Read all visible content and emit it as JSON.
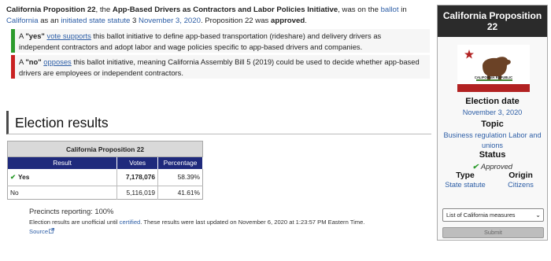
{
  "intro": {
    "title_bold": "California Proposition 22",
    "t1": ", the ",
    "initiative_name": "App-Based Drivers as Contractors and Labor Policies Initiative",
    "t2": ", was on the ",
    "link_ballot": "ballot",
    "t3": " in ",
    "link_state": "California",
    "t4": " as an ",
    "link_type": "initiated state statute",
    "t5": " 3 ",
    "link_date": "November 3, 2020",
    "t6": ". Proposition 22 was ",
    "outcome": "approved",
    "t7": "."
  },
  "yes_box": {
    "a": "A ",
    "vote": "\"yes\"",
    "space": " ",
    "link": "vote supports",
    "rest": " this ballot initiative to define app-based transportation (rideshare) and delivery drivers as independent contractors and adopt labor and wage policies specific to app-based drivers and companies."
  },
  "no_box": {
    "a": "A ",
    "vote": "\"no\"",
    "space": " ",
    "link": "opposes",
    "rest": " this ballot initiative, meaning California Assembly Bill 5 (2019) could be used to decide whether app-based drivers are employees or independent contractors."
  },
  "section_heading": "Election results",
  "results_table": {
    "caption": "California Proposition 22",
    "headers": [
      "Result",
      "Votes",
      "Percentage"
    ],
    "rows": [
      {
        "result": "Yes",
        "votes": "7,178,076",
        "percentage": "58.39%",
        "winner": true
      },
      {
        "result": "No",
        "votes": "5,116,019",
        "percentage": "41.61%",
        "winner": false
      }
    ]
  },
  "precincts": "Precincts reporting: 100%",
  "results_note": {
    "a": "Election results are unofficial until ",
    "link": "certified",
    "b": ". These results were last updated on November 6, 2020 at 1:23:57 PM Eastern Time.",
    "source": "Source"
  },
  "infobox": {
    "title": "California Proposition 22",
    "flag_text": "CALIFORNIA REPUBLIC",
    "election_date_label": "Election date",
    "election_date": "November 3, 2020",
    "topic_label": "Topic",
    "topic": "Business regulation Labor and unions",
    "status_label": "Status",
    "status": "Approved",
    "type_label": "Type",
    "type": "State statute",
    "origin_label": "Origin",
    "origin": "Citizens",
    "select_value": "List of California measures",
    "submit_label": "Submit"
  },
  "colors": {
    "yes_bar": "#2c9b2c",
    "no_bar": "#c92121",
    "table_header": "#1f2a7c",
    "link": "#2d5ea6"
  }
}
